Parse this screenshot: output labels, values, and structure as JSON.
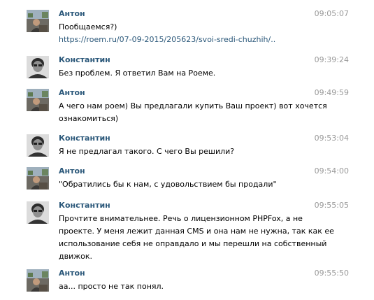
{
  "messages": [
    {
      "author": "Антон",
      "time": "09:05:07",
      "lines": [
        "Пообщаемся?)"
      ],
      "link": "https://roem.ru/07-09-2015/205623/svoi-sredi-chuzhih/.."
    },
    {
      "author": "Константин",
      "time": "09:39:24",
      "lines": [
        "Без проблем. Я ответил Вам на Роеме."
      ]
    },
    {
      "author": "Антон",
      "time": "09:49:59",
      "lines": [
        "А чего нам роем) Вы предлагали купить Ваш проект) вот хочется",
        "ознакомиться)"
      ]
    },
    {
      "author": "Константин",
      "time": "09:53:04",
      "lines": [
        "Я не предлагал такого. С чего Вы решили?"
      ]
    },
    {
      "author": "Антон",
      "time": "09:54:00",
      "lines": [
        "\"Обратились бы к нам, с удовольствием бы продали\""
      ]
    },
    {
      "author": "Константин",
      "time": "09:55:05",
      "lines": [
        "Прочтите внимательнее. Речь о лицензионном PHPFox, а не",
        "проекте. У меня лежит данная CMS и она нам не нужна, так как ее",
        "использование себя не оправдало и мы перешли на собственный",
        "движок."
      ]
    },
    {
      "author": "Антон",
      "time": "09:55:50",
      "lines": [
        "аа... просто не так понял."
      ]
    }
  ]
}
